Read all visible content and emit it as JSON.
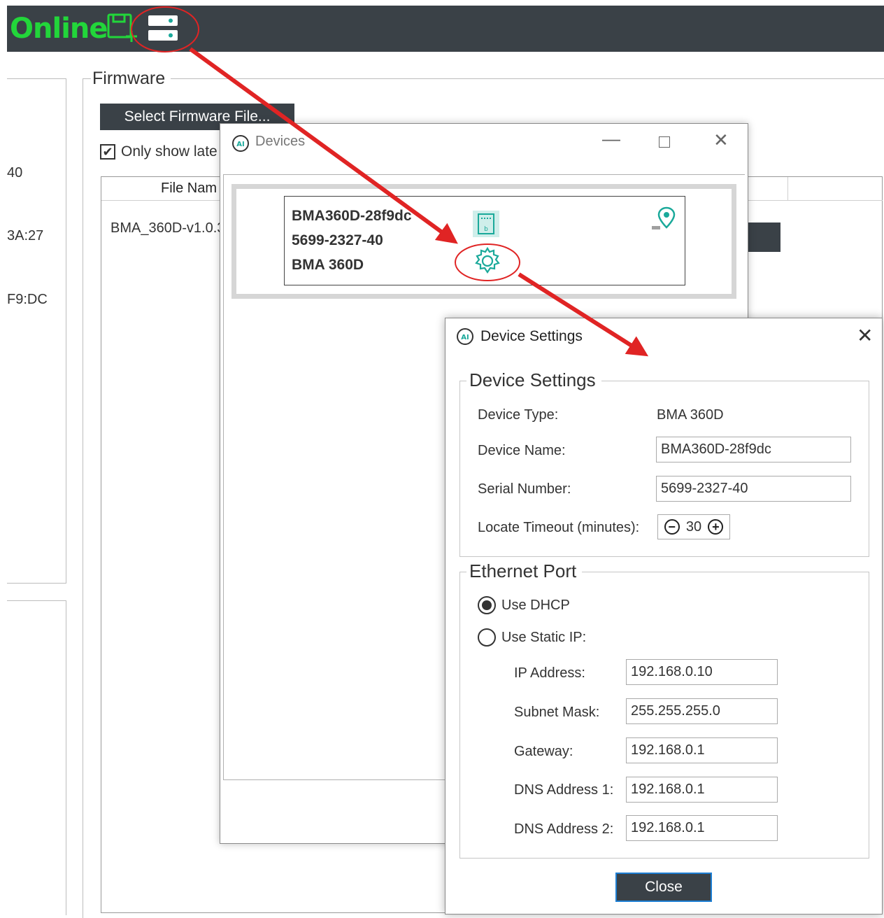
{
  "toolbar": {
    "status_label": "Online",
    "status_color": "#22d63a",
    "icons": [
      "save-add-icon",
      "devices-server-icon"
    ]
  },
  "firmware": {
    "legend": "Firmware",
    "select_button": "Select Firmware File...",
    "only_show_label": "Only show late",
    "only_show_checked": true,
    "file_table": {
      "header": "File Nam",
      "rows": [
        "BMA_360D-v1.0.3"
      ]
    }
  },
  "left_panel_fragments": [
    "40",
    "3A:27",
    "F9:DC"
  ],
  "devices_window": {
    "title": "Devices",
    "device": {
      "name": "BMA360D-28f9dc",
      "serial": "5699-2327-40",
      "type": "BMA 360D"
    },
    "icons": [
      "device-identify-icon",
      "settings-gear-icon",
      "locate-pin-icon"
    ]
  },
  "device_settings": {
    "window_title": "Device Settings",
    "section_title": "Device Settings",
    "device_type_label": "Device Type:",
    "device_type_value": "BMA 360D",
    "device_name_label": "Device Name:",
    "device_name_value": "BMA360D-28f9dc",
    "serial_label": "Serial Number:",
    "serial_value": "5699-2327-40",
    "timeout_label": "Locate Timeout (minutes):",
    "timeout_value": "30",
    "ethernet_title": "Ethernet Port",
    "use_dhcp_label": "Use DHCP",
    "use_static_label": "Use Static IP:",
    "dhcp_selected": true,
    "ip_label": "IP Address:",
    "ip_value": "192.168.0.10",
    "subnet_label": "Subnet Mask:",
    "subnet_value": "255.255.255.0",
    "gateway_label": "Gateway:",
    "gateway_value": "192.168.0.1",
    "dns1_label": "DNS Address 1:",
    "dns1_value": "192.168.0.1",
    "dns2_label": "DNS Address 2:",
    "dns2_value": "192.168.0.1",
    "close_button": "Close"
  },
  "colors": {
    "toolbar_bg": "#3a4147",
    "accent_teal": "#1aa99a",
    "annotation_red": "#e02424",
    "close_button_border": "#1e7fd4"
  }
}
